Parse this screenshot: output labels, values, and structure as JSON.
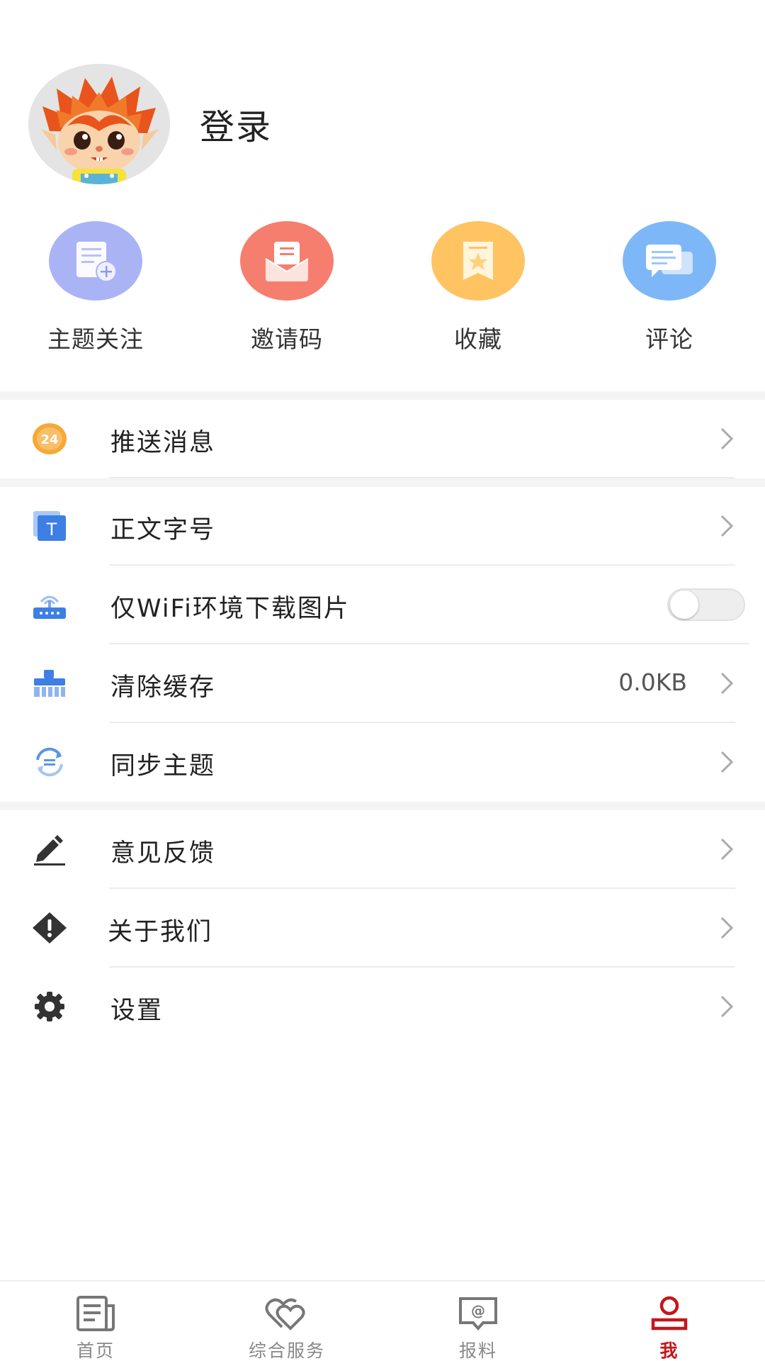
{
  "profile": {
    "login_label": "登录"
  },
  "quick_actions": [
    {
      "label": "主题关注",
      "icon": "topic-follow-icon",
      "color": "#aab4f5"
    },
    {
      "label": "邀请码",
      "icon": "invite-code-icon",
      "color": "#f67e6e"
    },
    {
      "label": "收藏",
      "icon": "favorites-icon",
      "color": "#ffc461"
    },
    {
      "label": "评论",
      "icon": "comments-icon",
      "color": "#7eb7f7"
    }
  ],
  "settings": {
    "push": {
      "label": "推送消息",
      "icon": "24-hour-icon"
    },
    "font_size": {
      "label": "正文字号",
      "icon": "text-size-icon"
    },
    "wifi_images": {
      "label": "仅WiFi环境下载图片",
      "icon": "router-icon",
      "enabled": false
    },
    "clear_cache": {
      "label": "清除缓存",
      "value": "0.0KB",
      "icon": "broom-icon"
    },
    "sync_topics": {
      "label": "同步主题",
      "icon": "sync-icon"
    },
    "feedback": {
      "label": "意见反馈",
      "icon": "pencil-icon"
    },
    "about": {
      "label": "关于我们",
      "icon": "warning-diamond-icon"
    },
    "settings": {
      "label": "设置",
      "icon": "gear-icon"
    }
  },
  "tabs": [
    {
      "label": "首页",
      "icon": "newspaper-icon",
      "active": false
    },
    {
      "label": "综合服务",
      "icon": "hearts-icon",
      "active": false
    },
    {
      "label": "报料",
      "icon": "at-message-icon",
      "active": false
    },
    {
      "label": "我",
      "icon": "user-icon",
      "active": true
    }
  ],
  "colors": {
    "accent": "#c4161c",
    "divider": "#ececec",
    "section_gap": "#f4f4f4"
  }
}
